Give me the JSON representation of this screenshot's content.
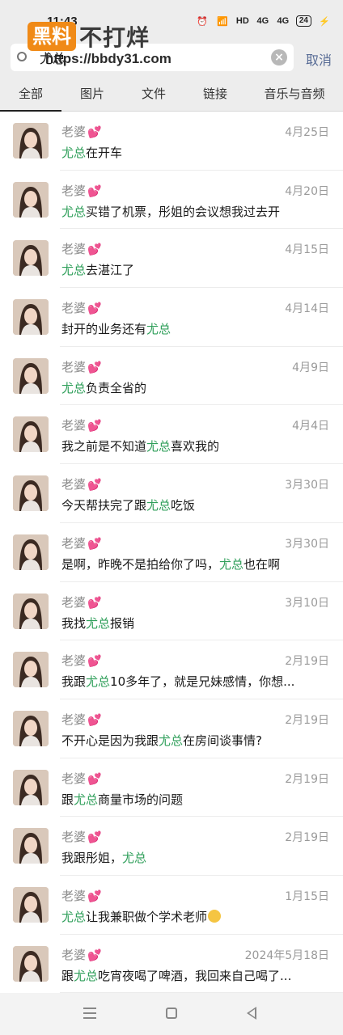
{
  "status_bar": {
    "time": "11:43",
    "alarm_icon": "alarm-icon",
    "wifi_icon": "wifi-icon",
    "hd_label": "HD",
    "signal_1": "4G",
    "signal_2": "4G",
    "battery": "24"
  },
  "watermark": {
    "badge": "黑料",
    "text": "不打烊",
    "url": "https://bbdy31.com"
  },
  "search": {
    "value": "尤总",
    "cancel_label": "取消"
  },
  "tabs": [
    "全部",
    "图片",
    "文件",
    "链接",
    "音乐与音频"
  ],
  "highlight_color": "#2f9f5a",
  "results": [
    {
      "sender": "老婆",
      "date": "4月25日",
      "message": [
        "",
        "尤总",
        "在开车"
      ]
    },
    {
      "sender": "老婆",
      "date": "4月20日",
      "message": [
        "",
        "尤总",
        "买错了机票，彤姐的会议想我过去开"
      ]
    },
    {
      "sender": "老婆",
      "date": "4月15日",
      "message": [
        "",
        "尤总",
        "去湛江了"
      ]
    },
    {
      "sender": "老婆",
      "date": "4月14日",
      "message": [
        "封开的业务还有",
        "尤总",
        ""
      ]
    },
    {
      "sender": "老婆",
      "date": "4月9日",
      "message": [
        "",
        "尤总",
        "负责全省的"
      ]
    },
    {
      "sender": "老婆",
      "date": "4月4日",
      "message": [
        "我之前是不知道",
        "尤总",
        "喜欢我的"
      ]
    },
    {
      "sender": "老婆",
      "date": "3月30日",
      "message": [
        "今天帮扶完了跟",
        "尤总",
        "吃饭"
      ]
    },
    {
      "sender": "老婆",
      "date": "3月30日",
      "message": [
        "是啊，昨晚不是拍给你了吗，",
        "尤总",
        "也在啊"
      ]
    },
    {
      "sender": "老婆",
      "date": "3月10日",
      "message": [
        "我找",
        "尤总",
        "报销"
      ]
    },
    {
      "sender": "老婆",
      "date": "2月19日",
      "message": [
        "我跟",
        "尤总",
        "10多年了，就是兄妹感情，你想..."
      ]
    },
    {
      "sender": "老婆",
      "date": "2月19日",
      "message": [
        "不开心是因为我跟",
        "尤总",
        "在房间谈事情?"
      ]
    },
    {
      "sender": "老婆",
      "date": "2月19日",
      "message": [
        "跟",
        "尤总",
        "商量市场的问题"
      ]
    },
    {
      "sender": "老婆",
      "date": "2月19日",
      "message": [
        "我跟彤姐，",
        "尤总",
        ""
      ]
    },
    {
      "sender": "老婆",
      "date": "1月15日",
      "message": [
        "",
        "尤总",
        "让我兼职做个学术老师"
      ],
      "emoji": "smile-emoji-icon"
    },
    {
      "sender": "老婆",
      "date": "2024年5月18日",
      "message": [
        "跟",
        "尤总",
        "吃宵夜喝了啤酒，我回来自己喝了..."
      ]
    }
  ]
}
